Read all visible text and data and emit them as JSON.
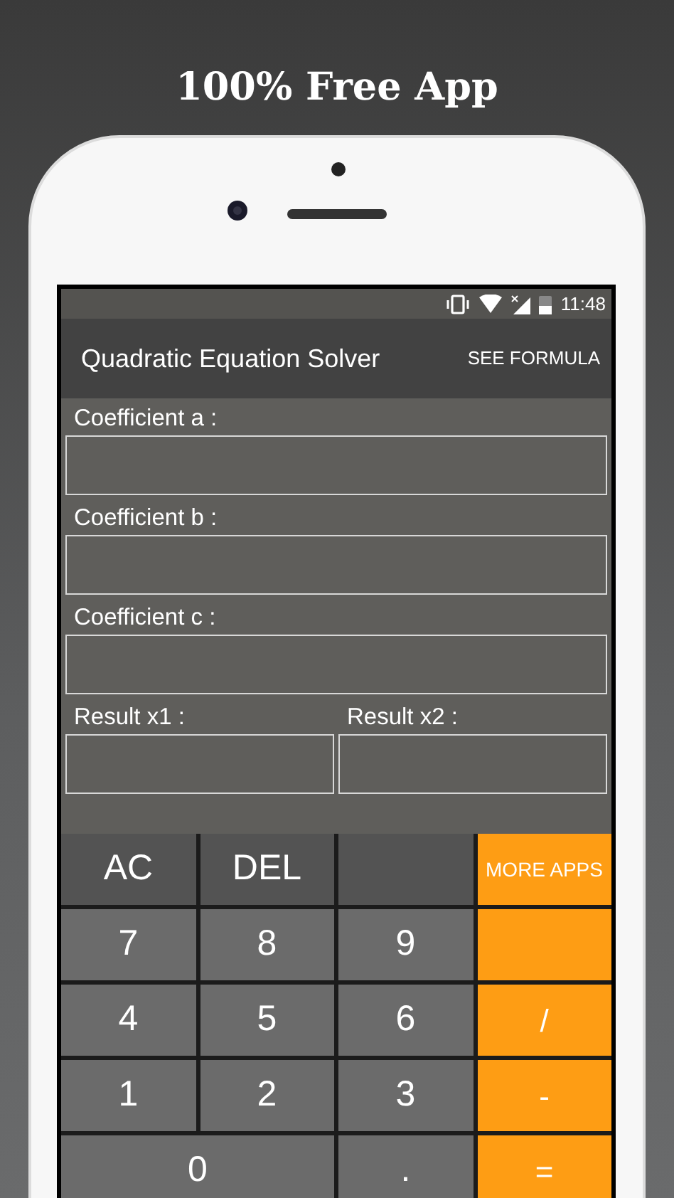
{
  "headline": "100% Free App",
  "status_bar": {
    "time": "11:48"
  },
  "app_bar": {
    "title": "Quadratic Equation Solver",
    "action": "SEE FORMULA"
  },
  "fields": [
    {
      "label": "Coefficient a :"
    },
    {
      "label": "Coefficient b :"
    },
    {
      "label": "Coefficient c :"
    }
  ],
  "results": [
    {
      "label": "Result x1 :"
    },
    {
      "label": "Result x2 :"
    }
  ],
  "keys": [
    {
      "label": "AC",
      "kind": "dark"
    },
    {
      "label": "DEL",
      "kind": "dark"
    },
    {
      "kind": "dark"
    },
    {
      "label": "MORE APPS",
      "kind": "orange"
    },
    {
      "label": "7",
      "kind": "digit"
    },
    {
      "label": "8",
      "kind": "digit"
    },
    {
      "label": "9",
      "kind": "digit"
    },
    {
      "kind": "orange"
    },
    {
      "label": "4",
      "kind": "digit"
    },
    {
      "label": "5",
      "kind": "digit"
    },
    {
      "label": "6",
      "kind": "digit"
    },
    {
      "label": "/",
      "kind": "orange"
    },
    {
      "label": "1",
      "kind": "digit"
    },
    {
      "label": "2",
      "kind": "digit"
    },
    {
      "label": "3",
      "kind": "digit"
    },
    {
      "label": "-",
      "kind": "orange"
    },
    {
      "label": "0",
      "kind": "wide"
    },
    {
      "label": ".",
      "kind": "digit"
    },
    {
      "label": "=",
      "kind": "orange"
    }
  ]
}
